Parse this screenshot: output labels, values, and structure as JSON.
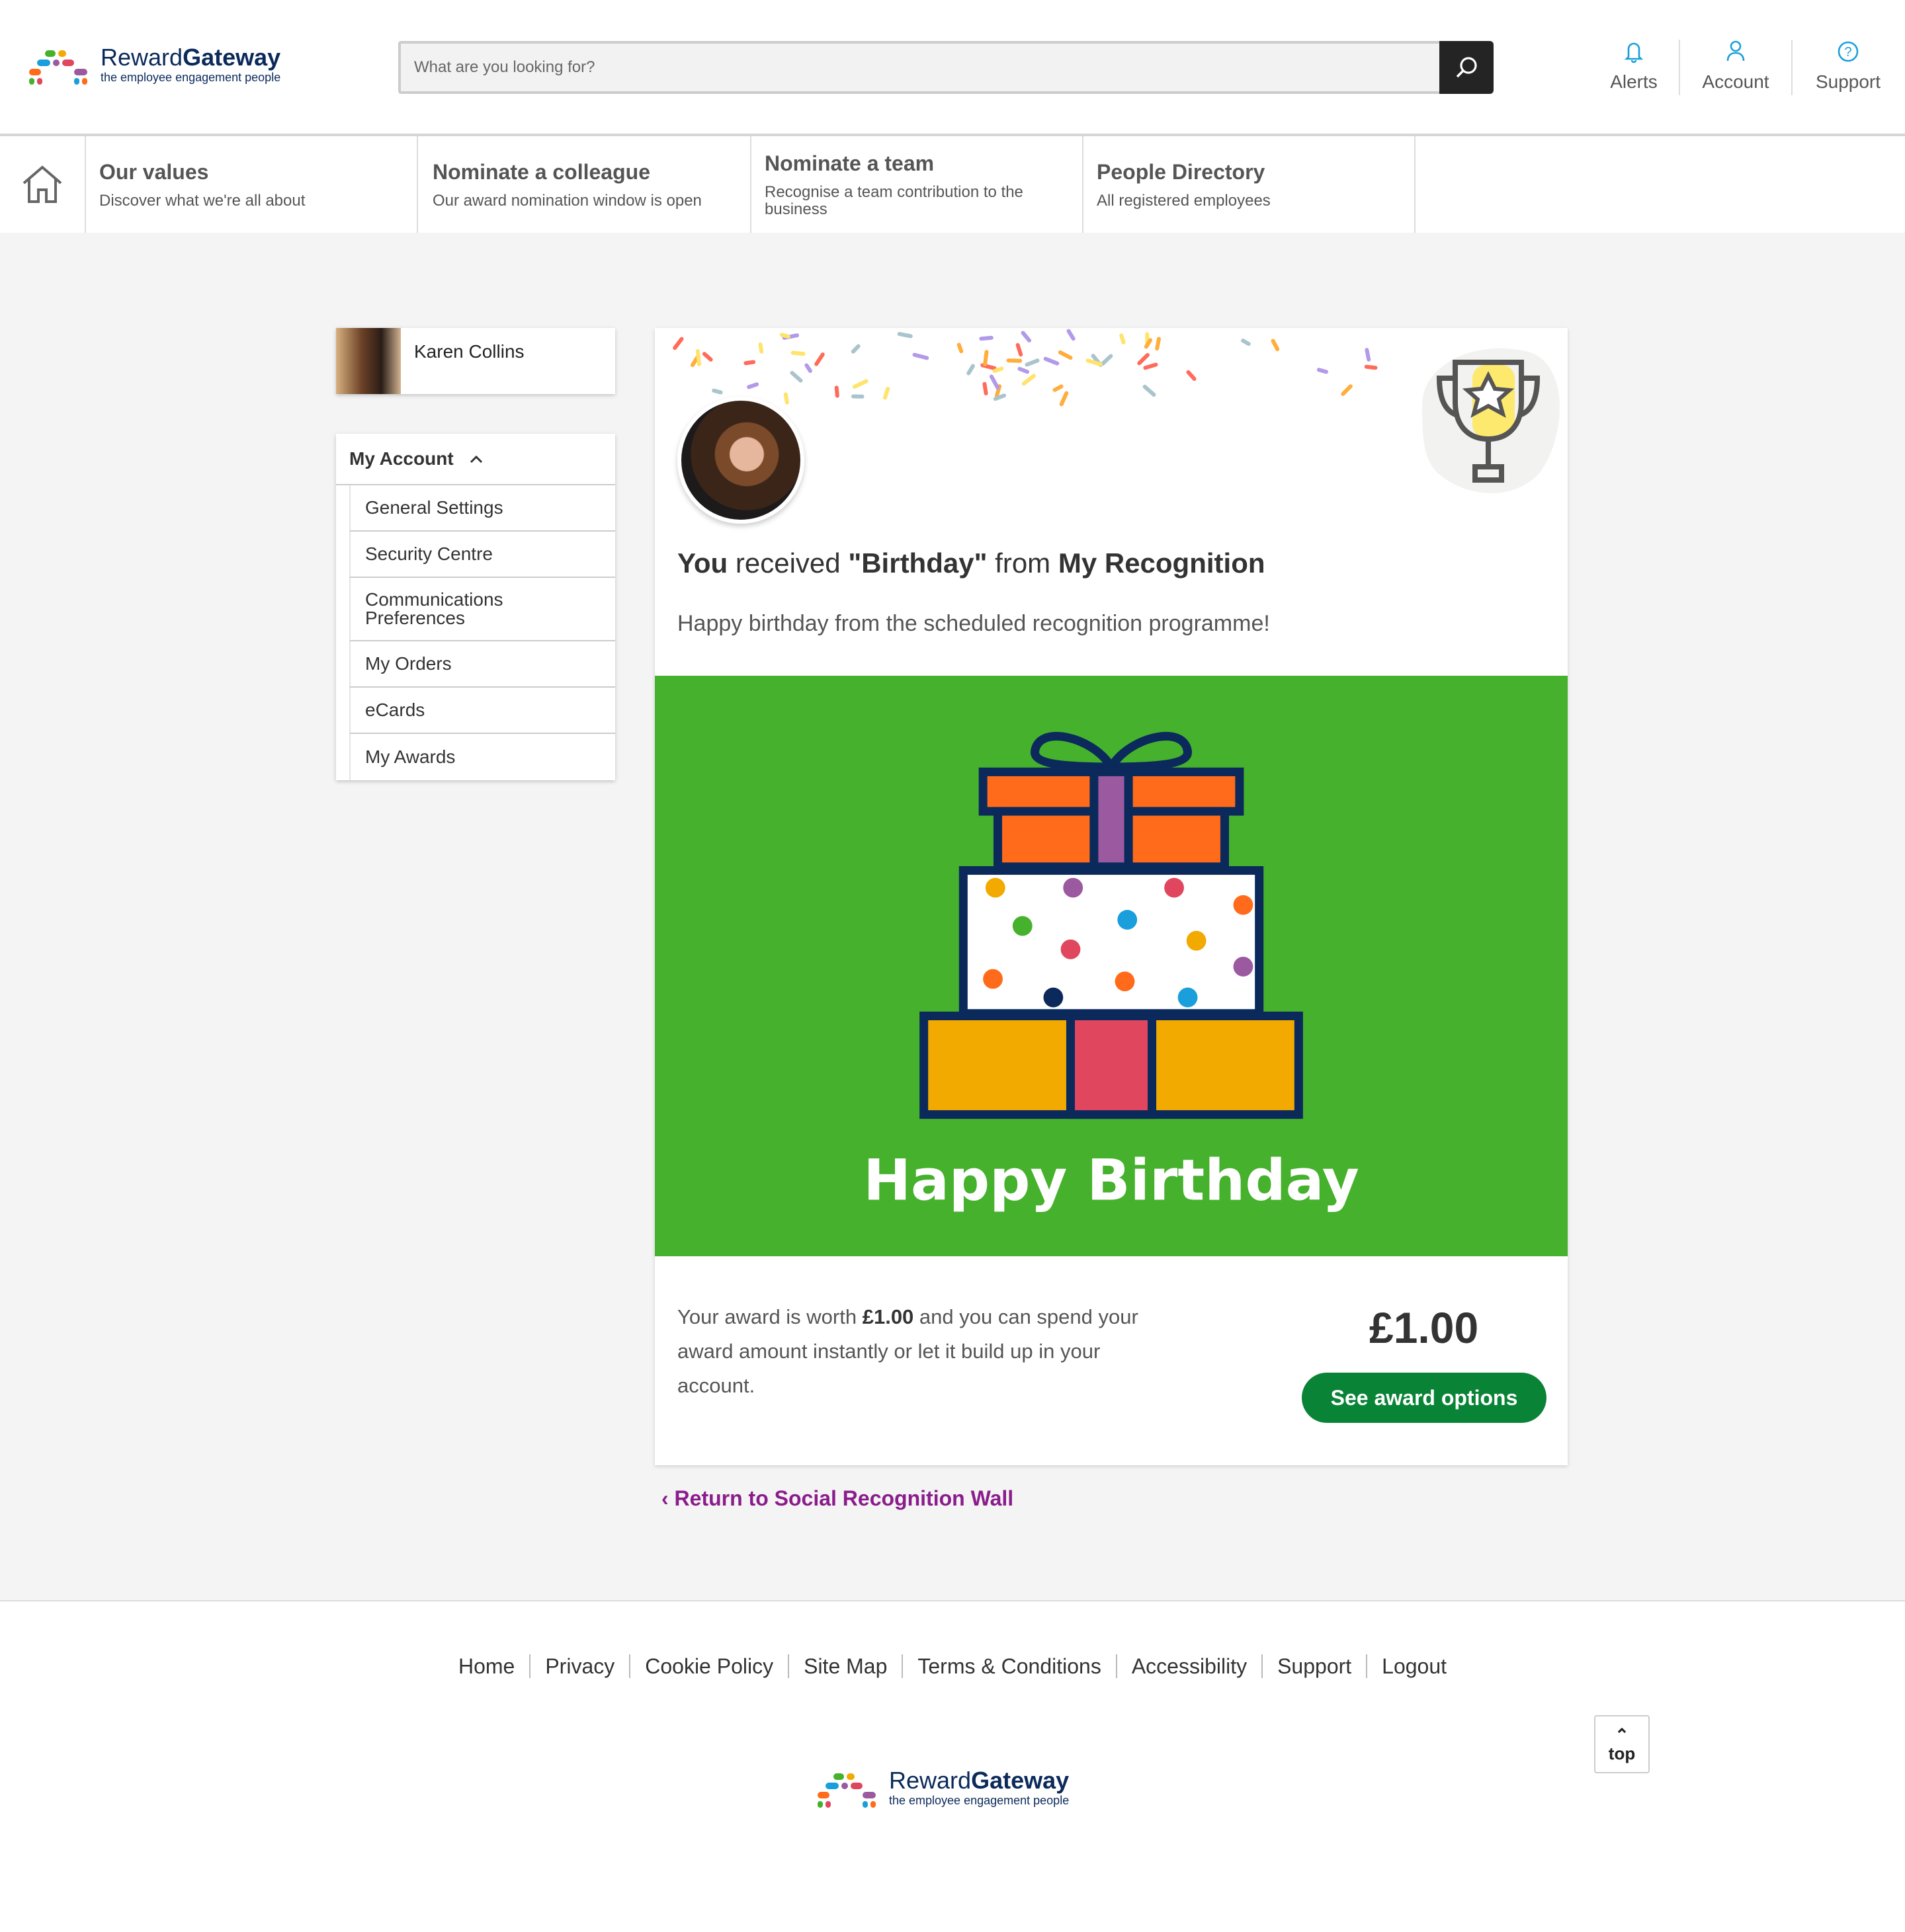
{
  "brand": {
    "name_light": "Reward",
    "name_bold": "Gateway",
    "tagline": "the employee engagement people"
  },
  "search": {
    "placeholder": "What are you looking for?",
    "icon": "search-icon"
  },
  "utility": [
    {
      "label": "Alerts",
      "icon": "bell-icon"
    },
    {
      "label": "Account",
      "icon": "user-icon"
    },
    {
      "label": "Support",
      "icon": "help-circle-icon"
    }
  ],
  "nav": {
    "home_icon": "home-icon",
    "items": [
      {
        "title": "Our values",
        "subtitle": "Discover what we're all about"
      },
      {
        "title": "Nominate a colleague",
        "subtitle": "Our award nomination window is open"
      },
      {
        "title": "Nominate a team",
        "subtitle": "Recognise a team contribution to the business"
      },
      {
        "title": "People Directory",
        "subtitle": "All registered employees"
      }
    ]
  },
  "profile": {
    "name": "Karen Collins"
  },
  "sidebar": {
    "heading": "My Account",
    "items": [
      "General Settings",
      "Security Centre",
      "Communications Preferences",
      "My Orders",
      "eCards",
      "My Awards"
    ]
  },
  "award": {
    "title_pre": "You",
    "title_mid": " received ",
    "title_award": "\"Birthday\"",
    "title_from": " from ",
    "title_sender": "My Recognition",
    "message": "Happy birthday from the scheduled recognition programme!",
    "ecard_text": "Happy Birthday",
    "ecard_bg": "#46b12c",
    "worth_pre": "Your award is worth ",
    "worth_value": "£1.00",
    "worth_post": " and you can spend your award amount instantly or let it build up in your account.",
    "amount": "£1.00",
    "button": "See award options"
  },
  "return_link": "‹ Return to Social Recognition Wall",
  "footer": {
    "links": [
      "Home",
      "Privacy",
      "Cookie Policy",
      "Site Map",
      "Terms & Conditions",
      "Accessibility",
      "Support",
      "Logout"
    ],
    "top_label": "top"
  },
  "colors": {
    "accent_link": "#8a1c8c",
    "button_green": "#098336",
    "icon_blue": "#1a9fdc"
  }
}
